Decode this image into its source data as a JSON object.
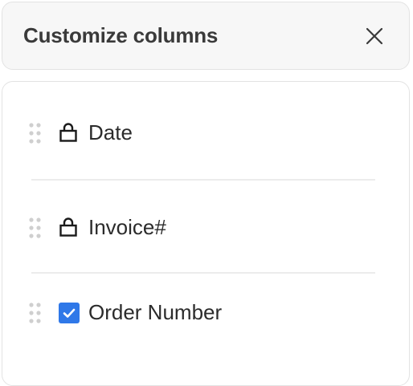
{
  "dialog": {
    "title": "Customize columns"
  },
  "columns": [
    {
      "label": "Date",
      "state": "locked"
    },
    {
      "label": "Invoice#",
      "state": "locked"
    },
    {
      "label": "Order Number",
      "state": "checked"
    }
  ],
  "colors": {
    "checkbox_accent": "#2f78e8",
    "header_bg": "#f7f7f7",
    "border": "#e3e3e3"
  },
  "icons": {
    "close": "close-icon",
    "drag": "drag-handle-icon",
    "lock": "lock-icon",
    "checkbox": "checkbox-checked-icon"
  }
}
